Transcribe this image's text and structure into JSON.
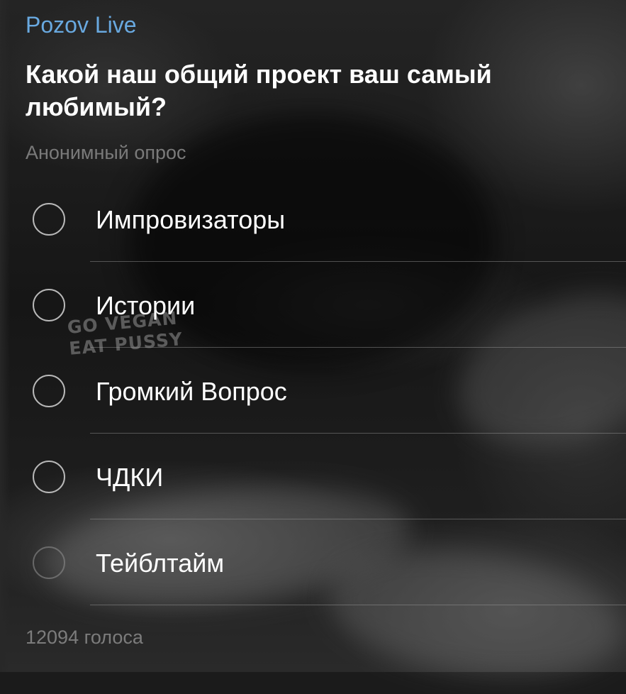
{
  "channel": {
    "name": "Pozov Live"
  },
  "poll": {
    "question": "Какой наш общий проект ваш самый любимый?",
    "type": "Анонимный опрос",
    "options": [
      {
        "label": "Импровизаторы"
      },
      {
        "label": "Истории"
      },
      {
        "label": "Громкий Вопрос"
      },
      {
        "label": "ЧДКИ"
      },
      {
        "label": "Тейблтайм"
      }
    ],
    "votes": "12094 голоса"
  },
  "background": {
    "watermark_line1": "GO VEGAN",
    "watermark_line2": "EAT PUSSY"
  },
  "colors": {
    "channel_accent": "#69a9e0",
    "text_primary": "#ffffff",
    "text_secondary": "#7a7a7a",
    "radio_border": "#b8b8b8"
  }
}
